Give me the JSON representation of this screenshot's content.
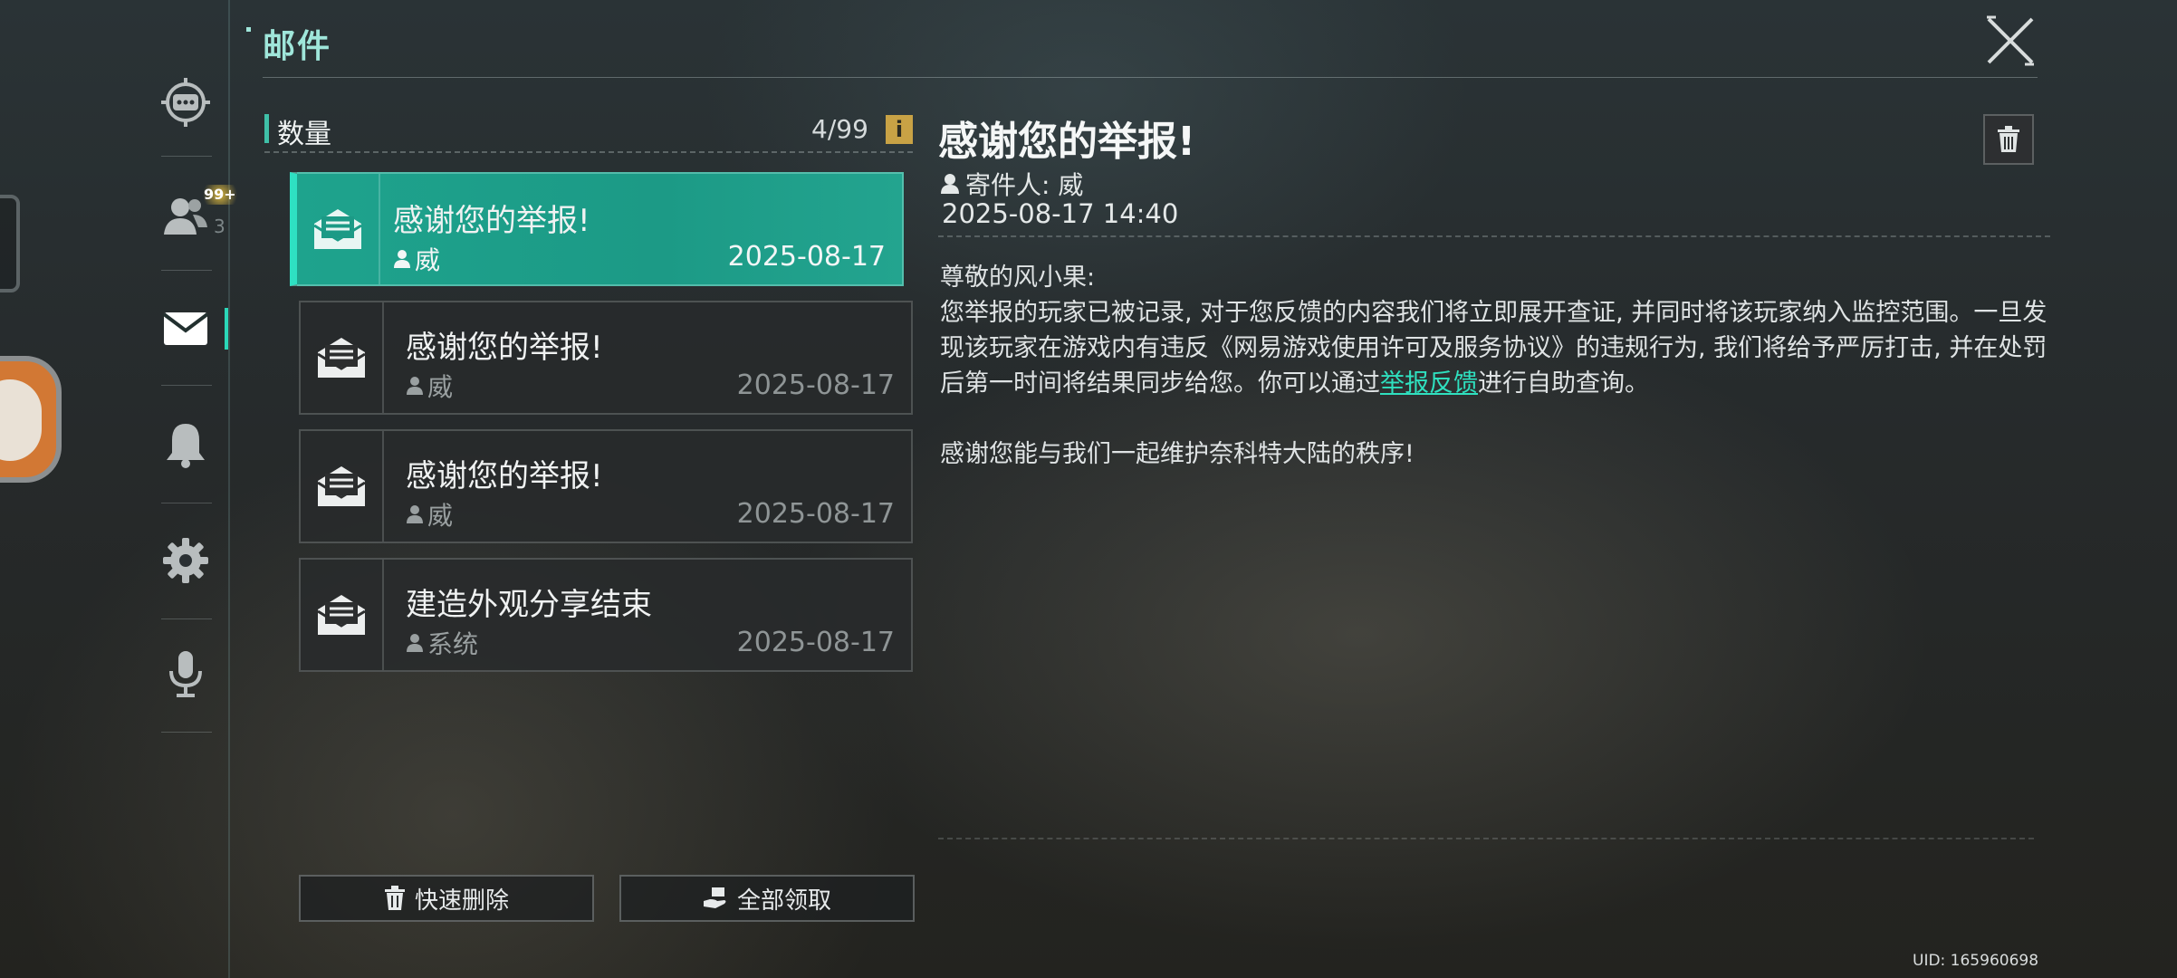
{
  "header": {
    "title": "邮件"
  },
  "sidebar": {
    "items": [
      {
        "name": "chat",
        "icon": "chat-bubble-icon"
      },
      {
        "name": "friends",
        "icon": "friends-icon",
        "badge": "99+",
        "count": "3"
      },
      {
        "name": "mail",
        "icon": "mail-icon",
        "active": true
      },
      {
        "name": "notifications",
        "icon": "bell-icon"
      },
      {
        "name": "settings",
        "icon": "gear-icon"
      },
      {
        "name": "voice",
        "icon": "microphone-icon"
      }
    ]
  },
  "mail_list": {
    "header_label": "数量",
    "count": "4/99",
    "info_icon": "i",
    "items": [
      {
        "subject": "感谢您的举报!",
        "sender": "威",
        "date": "2025-08-17",
        "selected": true
      },
      {
        "subject": "感谢您的举报!",
        "sender": "威",
        "date": "2025-08-17",
        "selected": false
      },
      {
        "subject": "感谢您的举报!",
        "sender": "威",
        "date": "2025-08-17",
        "selected": false
      },
      {
        "subject": "建造外观分享结束",
        "sender": "系统",
        "date": "2025-08-17",
        "selected": false
      }
    ],
    "quick_delete_label": "快速删除",
    "claim_all_label": "全部领取"
  },
  "detail": {
    "title": "感谢您的举报!",
    "sender_label": "寄件人: 威",
    "datetime": "2025-08-17 14:40",
    "greeting": "尊敬的风小果:",
    "para1_before_link": "您举报的玩家已被记录, 对于您反馈的内容我们将立即展开查证, 并同时将该玩家纳入监控范围。一旦发现该玩家在游戏内有违反《网易游戏使用许可及服务协议》的违规行为, 我们将给予严厉打击, 并在处罚后第一时间将结果同步给您。你可以通过",
    "link_text": "举报反馈",
    "para1_after_link": "进行自助查询。",
    "para2": "感谢您能与我们一起维护奈科特大陆的秩序!"
  },
  "footer": {
    "uid": "UID: 165960698"
  },
  "colors": {
    "accent": "#2ee0c2",
    "selected_item": "#1ea38d",
    "title": "#9fe6da",
    "link": "#2fe0bf"
  }
}
